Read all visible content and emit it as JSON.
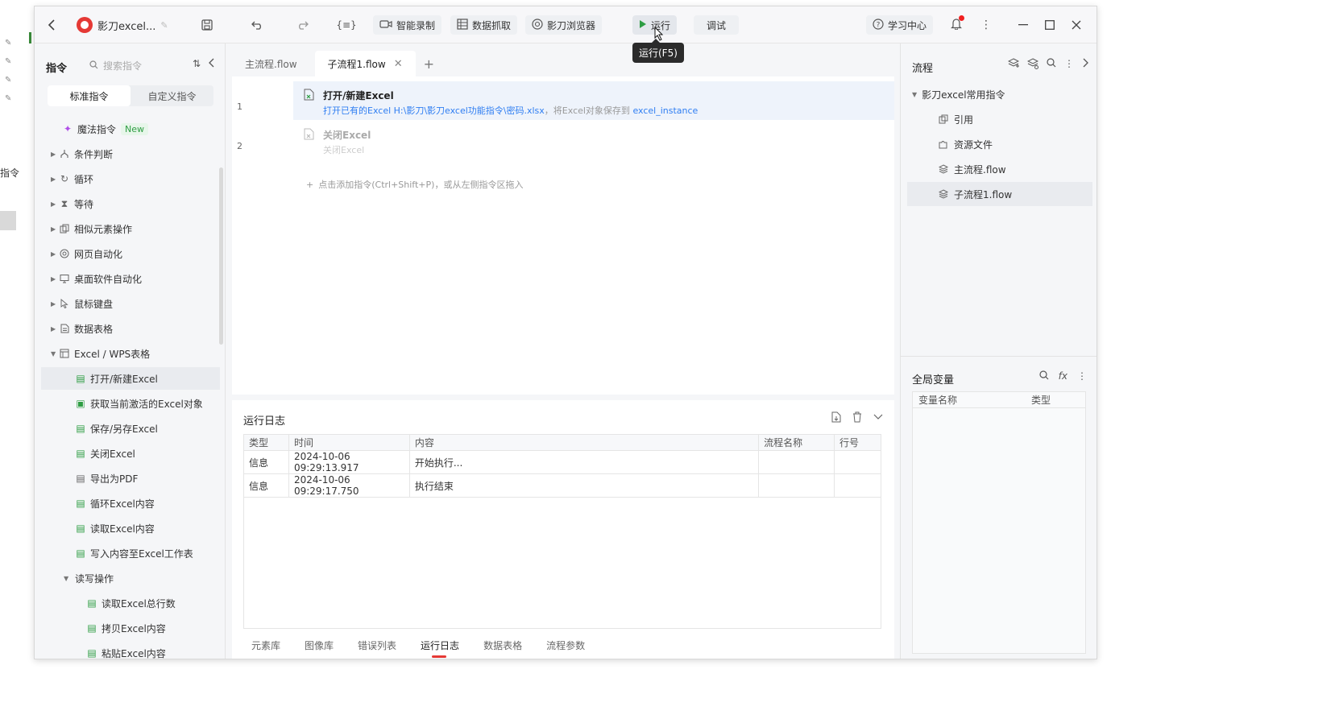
{
  "outside": {
    "cut_label": "指令"
  },
  "topbar": {
    "app_title": "影刀excel...",
    "record_label": "智能录制",
    "grab_label": "数据抓取",
    "browser_label": "影刀浏览器",
    "run_label": "运行",
    "debug_label": "调试",
    "learn_label": "学习中心",
    "run_tooltip": "运行(F5)"
  },
  "left": {
    "title": "指令",
    "search_placeholder": "搜索指令",
    "tab_standard": "标准指令",
    "tab_custom": "自定义指令",
    "items": [
      {
        "label": "魔法指令",
        "badge": "New"
      },
      {
        "label": "条件判断"
      },
      {
        "label": "循环"
      },
      {
        "label": "等待"
      },
      {
        "label": "相似元素操作"
      },
      {
        "label": "网页自动化"
      },
      {
        "label": "桌面软件自动化"
      },
      {
        "label": "鼠标键盘"
      },
      {
        "label": "数据表格"
      },
      {
        "label": "Excel / WPS表格"
      },
      {
        "label": "打开/新建Excel"
      },
      {
        "label": "获取当前激活的Excel对象"
      },
      {
        "label": "保存/另存Excel"
      },
      {
        "label": "关闭Excel"
      },
      {
        "label": "导出为PDF"
      },
      {
        "label": "循环Excel内容"
      },
      {
        "label": "读取Excel内容"
      },
      {
        "label": "写入内容至Excel工作表"
      },
      {
        "label": "读写操作"
      },
      {
        "label": "读取Excel总行数"
      },
      {
        "label": "拷贝Excel内容"
      },
      {
        "label": "粘贴Excel内容"
      }
    ]
  },
  "tabs": {
    "main": "主流程.flow",
    "sub": "子流程1.flow"
  },
  "editor": {
    "steps": [
      {
        "line": "1",
        "title": "打开/新建Excel",
        "desc_a": "打开已有的Excel H:\\影刀\\影刀excel功能指令\\密码.xlsx",
        "desc_b": "，将Excel对象保存到",
        "desc_c": "excel_instance"
      },
      {
        "line": "2",
        "title": "关闭Excel",
        "desc_a": "关闭Excel"
      }
    ],
    "add_hint": "点击添加指令(Ctrl+Shift+P)，或从左侧指令区拖入"
  },
  "log": {
    "title": "运行日志",
    "columns": [
      "类型",
      "时间",
      "内容",
      "流程名称",
      "行号"
    ],
    "rows": [
      [
        "信息",
        "2024-10-06 09:29:13.917",
        "开始执行...",
        "",
        ""
      ],
      [
        "信息",
        "2024-10-06 09:29:17.750",
        "执行结束",
        "",
        ""
      ]
    ],
    "bottom_tabs": [
      "元素库",
      "图像库",
      "错误列表",
      "运行日志",
      "数据表格",
      "流程参数"
    ]
  },
  "right": {
    "title": "流程",
    "root": "影刀excel常用指令",
    "items": [
      "引用",
      "资源文件",
      "主流程.flow",
      "子流程1.flow"
    ],
    "gv_title": "全局变量",
    "gv_col_name": "变量名称",
    "gv_col_type": "类型"
  },
  "colors": {
    "accent_red": "#e53935",
    "link_blue": "#2f7ef2",
    "run_green": "#2e9d43"
  }
}
